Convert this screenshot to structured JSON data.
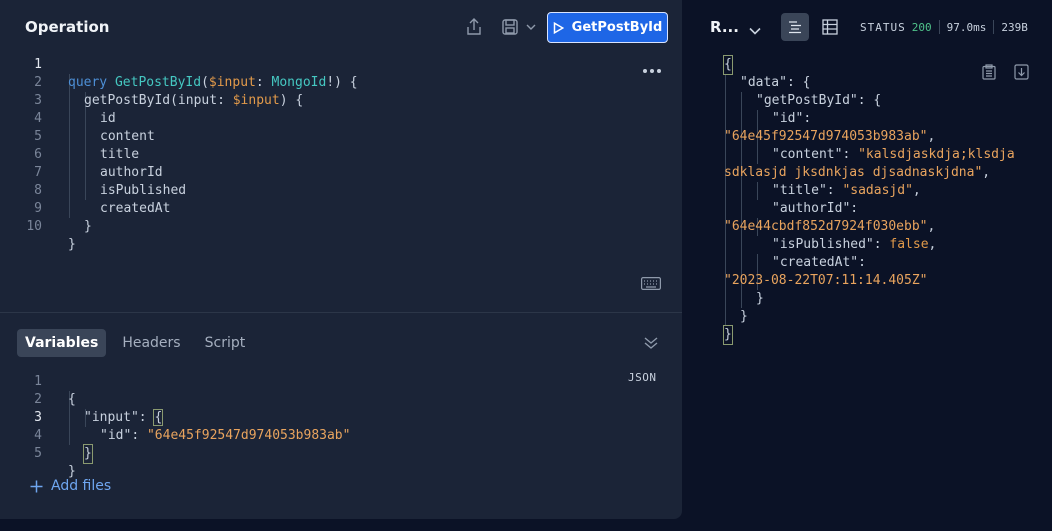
{
  "operation": {
    "title": "Operation",
    "run_label": "GetPostById",
    "editor": {
      "line_numbers": [
        "1",
        "2",
        "3",
        "4",
        "5",
        "6",
        "7",
        "8",
        "9",
        "10"
      ],
      "query_kw": "query",
      "op_name": "GetPostById",
      "var_name": "$input",
      "var_type": "MongoId",
      "field_root": "getPostById",
      "arg_name": "input",
      "fields": [
        "id",
        "content",
        "title",
        "authorId",
        "isPublished",
        "createdAt"
      ]
    }
  },
  "variables": {
    "tabs": [
      "Variables",
      "Headers",
      "Script"
    ],
    "active_tab": "Variables",
    "format_label": "JSON",
    "line_numbers": [
      "1",
      "2",
      "3",
      "4",
      "5"
    ],
    "input_key": "\"input\"",
    "id_key": "\"id\"",
    "id_value": "\"64e45f92547d974053b983ab\"",
    "add_files_label": "Add files"
  },
  "response": {
    "title": "R...",
    "status_label": "STATUS",
    "status_code": "200",
    "time": "97.0ms",
    "size": "239B",
    "body": {
      "data_key": "\"data\"",
      "root_key": "\"getPostById\"",
      "id_key": "\"id\"",
      "id_value": "\"64e45f92547d974053b983ab\"",
      "content_key": "\"content\"",
      "content_value_1": "\"kalsdjaskdja;klsdja",
      "content_value_2": "sdklasjd jksdnkjas djsadnaskjdna\"",
      "title_key": "\"title\"",
      "title_value": "\"sadasjd\"",
      "author_key": "\"authorId\"",
      "author_value": "\"64e44cbdf852d7924f030ebb\"",
      "published_key": "\"isPublished\"",
      "published_value": "false",
      "created_key": "\"createdAt\"",
      "created_value": "\"2023-08-22T07:11:14.405Z\""
    }
  },
  "colors": {
    "accent": "#1e66e6",
    "status_ok": "#4fc28a",
    "string": "#e9a45e",
    "keyword": "#4d8fd6"
  },
  "icons": [
    "share-icon",
    "save-icon",
    "chevron-down-icon",
    "play-icon",
    "more-icon",
    "keyboard-icon",
    "collapse-icon",
    "plus-icon",
    "list-view-icon",
    "table-view-icon",
    "copy-icon",
    "download-icon"
  ]
}
